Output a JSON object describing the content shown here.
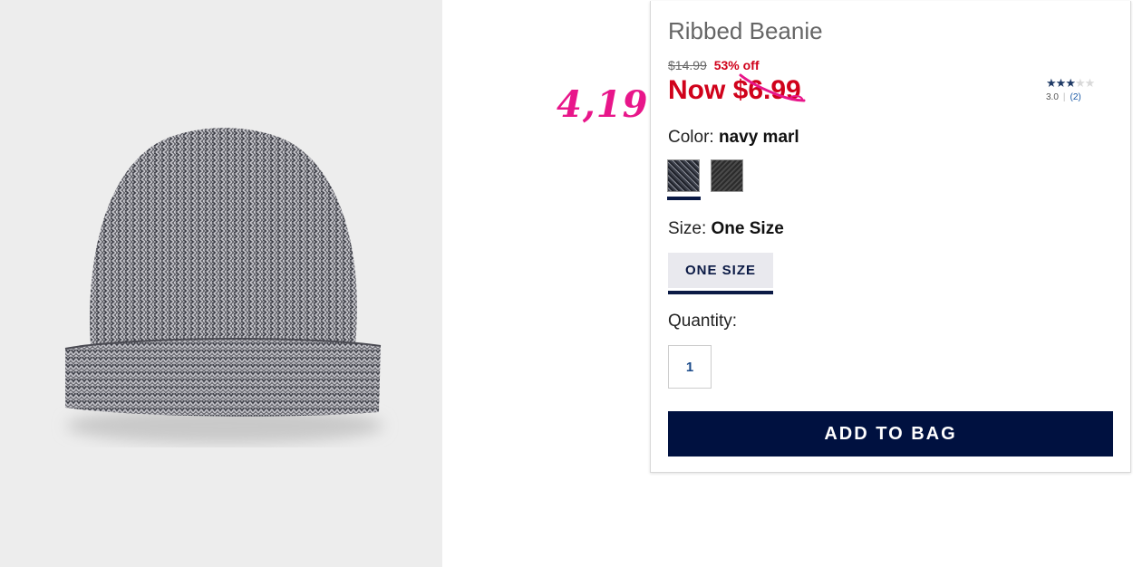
{
  "product": {
    "title": "Ribbed Beanie",
    "original_price": "$14.99",
    "discount": "53% off",
    "now_price": "Now $6.99",
    "image_icon": "knit-beanie-image"
  },
  "annotation": {
    "handwritten_price": "4,19",
    "color": "#e8168a"
  },
  "rating": {
    "stars_filled": 3,
    "stars_total": 5,
    "score": "3.0",
    "review_count": "(2)"
  },
  "color": {
    "label": "Color:",
    "selected": "navy marl",
    "swatches": [
      "navy marl",
      "charcoal"
    ]
  },
  "size": {
    "label": "Size:",
    "selected": "One Size",
    "option": "ONE SIZE"
  },
  "quantity": {
    "label": "Quantity:",
    "value": "1"
  },
  "actions": {
    "add_to_bag": "ADD TO BAG"
  },
  "colors": {
    "sale_red": "#d0021b",
    "navy": "#001140"
  }
}
